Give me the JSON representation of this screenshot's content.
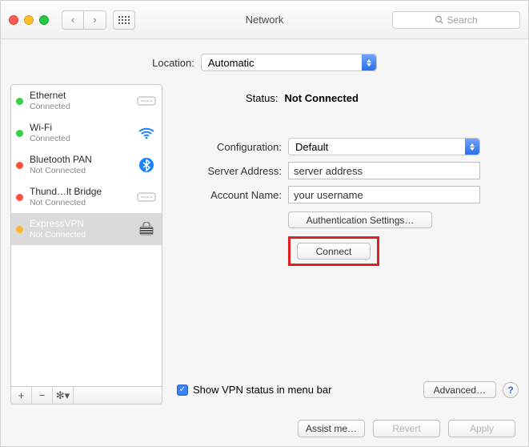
{
  "window": {
    "title": "Network"
  },
  "search": {
    "placeholder": "Search"
  },
  "location": {
    "label": "Location:",
    "value": "Automatic"
  },
  "sidebar": {
    "items": [
      {
        "name": "Ethernet",
        "status": "Connected",
        "dot": "green",
        "icon": "ethernet"
      },
      {
        "name": "Wi-Fi",
        "status": "Connected",
        "dot": "green",
        "icon": "wifi"
      },
      {
        "name": "Bluetooth PAN",
        "status": "Not Connected",
        "dot": "red",
        "icon": "bluetooth"
      },
      {
        "name": "Thund…lt Bridge",
        "status": "Not Connected",
        "dot": "red",
        "icon": "ethernet"
      },
      {
        "name": "ExpressVPN",
        "status": "Not Connected",
        "dot": "amber",
        "icon": "vpn",
        "selected": true
      }
    ]
  },
  "main": {
    "status_label": "Status:",
    "status_value": "Not Connected",
    "config_label": "Configuration:",
    "config_value": "Default",
    "server_label": "Server Address:",
    "server_value": "server address",
    "account_label": "Account Name:",
    "account_value": "your username",
    "auth_button": "Authentication Settings…",
    "connect_button": "Connect",
    "show_status_label": "Show VPN status in menu bar",
    "advanced_button": "Advanced…",
    "help": "?"
  },
  "footer": {
    "assist": "Assist me…",
    "revert": "Revert",
    "apply": "Apply"
  }
}
